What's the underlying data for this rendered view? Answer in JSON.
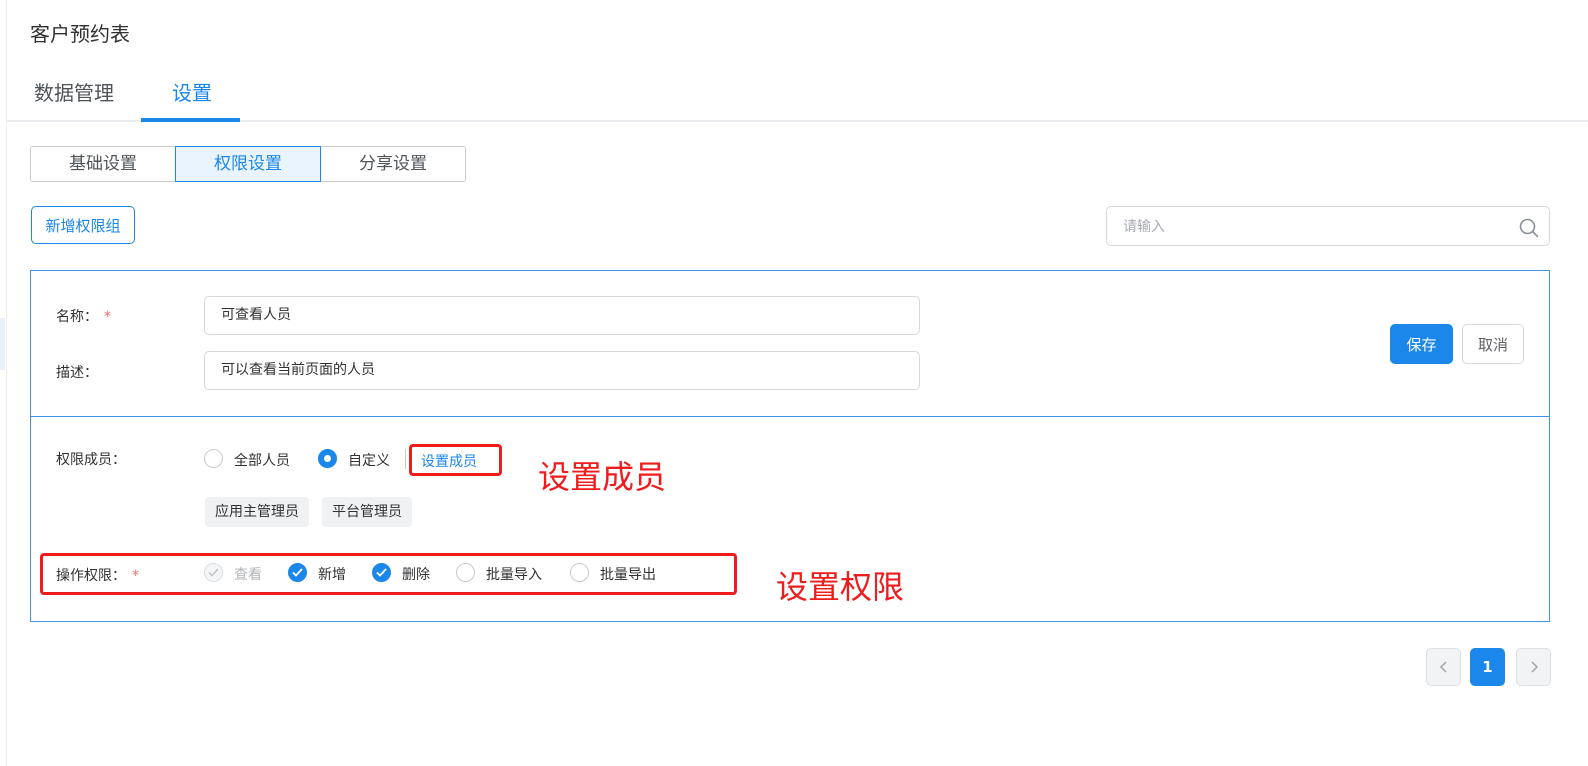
{
  "app": {
    "title": "客户预约表"
  },
  "tabs": [
    {
      "label": "数据管理",
      "active": false
    },
    {
      "label": "设置",
      "active": true
    }
  ],
  "segments": [
    {
      "label": "基础设置",
      "active": false
    },
    {
      "label": "权限设置",
      "active": true
    },
    {
      "label": "分享设置",
      "active": false
    }
  ],
  "toolbar": {
    "add_group_label": "新增权限组",
    "search_placeholder": "请输入",
    "search_value": ""
  },
  "group_form": {
    "name_label": "名称：",
    "name_required": "*",
    "name_value": "可查看人员",
    "desc_label": "描述：",
    "desc_value": "可以查看当前页面的人员",
    "save_label": "保存",
    "cancel_label": "取消",
    "members_label": "权限成员：",
    "member_options": [
      {
        "label": "全部人员",
        "checked": false
      },
      {
        "label": "自定义",
        "checked": true
      }
    ],
    "set_members_link": "设置成员",
    "member_tags": [
      "应用主管理员",
      "平台管理员"
    ],
    "ops_label": "操作权限：",
    "ops_required": "*",
    "operations": [
      {
        "label": "查看",
        "checked": true,
        "disabled": true
      },
      {
        "label": "新增",
        "checked": true,
        "disabled": false
      },
      {
        "label": "删除",
        "checked": true,
        "disabled": false
      },
      {
        "label": "批量导入",
        "checked": false,
        "disabled": false
      },
      {
        "label": "批量导出",
        "checked": false,
        "disabled": false
      }
    ]
  },
  "annotations": {
    "members_note": "设置成员",
    "permissions_note": "设置权限",
    "color": "#ee1c1c"
  },
  "pagination": {
    "current_page": "1",
    "prev_icon": "chevron-left-icon",
    "next_icon": "chevron-right-icon"
  },
  "theme": {
    "accent": "#1b87ea",
    "required": "#f56c6c"
  }
}
